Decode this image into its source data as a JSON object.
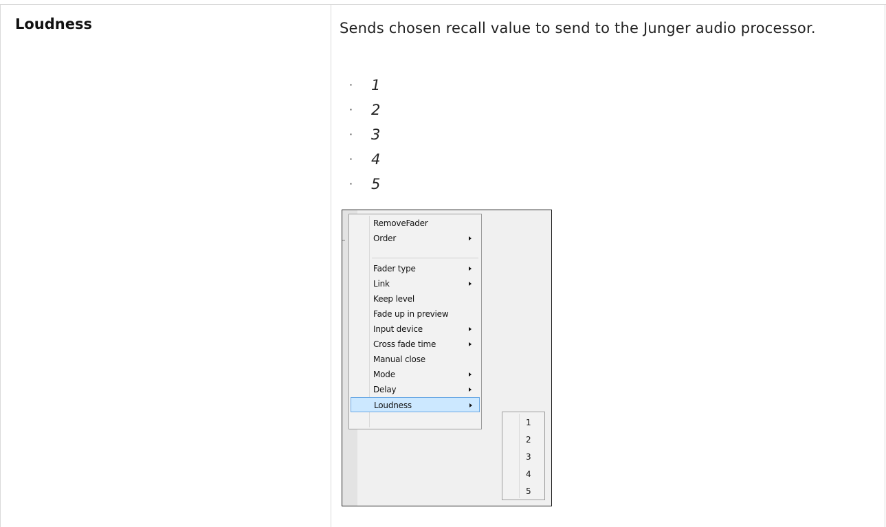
{
  "row": {
    "parameter": "Loudness",
    "description": "Sends chosen recall value to send to the Junger audio processor.",
    "values": [
      "1",
      "2",
      "3",
      "4",
      "5"
    ],
    "bullet": "·"
  },
  "context_menu": {
    "items": [
      {
        "label": "RemoveFader",
        "submenu": false
      },
      {
        "label": "Order",
        "submenu": true
      },
      {
        "label": "Fader type",
        "submenu": true
      },
      {
        "label": "Link",
        "submenu": true
      },
      {
        "label": "Keep level",
        "submenu": false
      },
      {
        "label": "Fade up in preview",
        "submenu": false
      },
      {
        "label": "Input device",
        "submenu": true
      },
      {
        "label": "Cross fade time",
        "submenu": true
      },
      {
        "label": "Manual close",
        "submenu": false
      },
      {
        "label": "Mode",
        "submenu": true
      },
      {
        "label": "Delay",
        "submenu": true
      },
      {
        "label": "Loudness",
        "submenu": true,
        "highlighted": true
      }
    ],
    "loudness_submenu": [
      "1",
      "2",
      "3",
      "4",
      "5"
    ]
  },
  "colors": {
    "highlight_bg": "#cce8ff",
    "highlight_border": "#6aa8e4",
    "menu_bg": "#f2f2f2"
  }
}
